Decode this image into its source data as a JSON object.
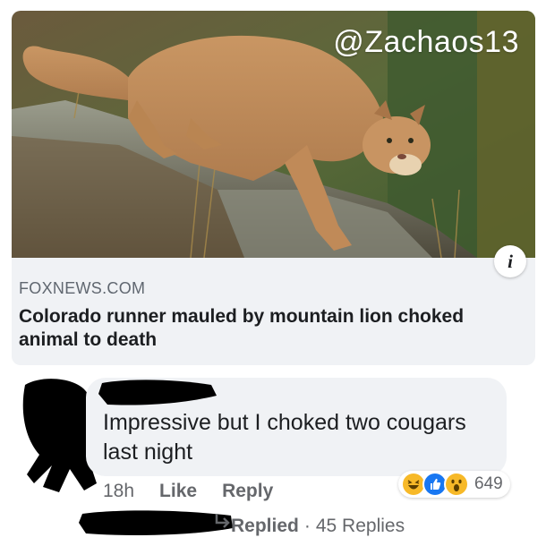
{
  "link_card": {
    "watermark": "@Zachaos13",
    "source": "FOXNEWS.COM",
    "headline": "Colorado runner mauled by mountain lion choked animal to death",
    "info_icon": "info-icon"
  },
  "comment": {
    "text": "Impressive but I choked two cougars last night",
    "time": "18h",
    "like_label": "Like",
    "reply_label": "Reply",
    "reaction_count": "649",
    "reactions": [
      "haha",
      "like",
      "wow"
    ]
  },
  "replies": {
    "label": "Replied",
    "separator": "·",
    "count": "45 Replies"
  },
  "colors": {
    "like_blue": "#1877f2",
    "reaction_yellow": "#f7b928",
    "bubble_gray": "#f0f2f5",
    "meta_gray": "#65676b"
  }
}
